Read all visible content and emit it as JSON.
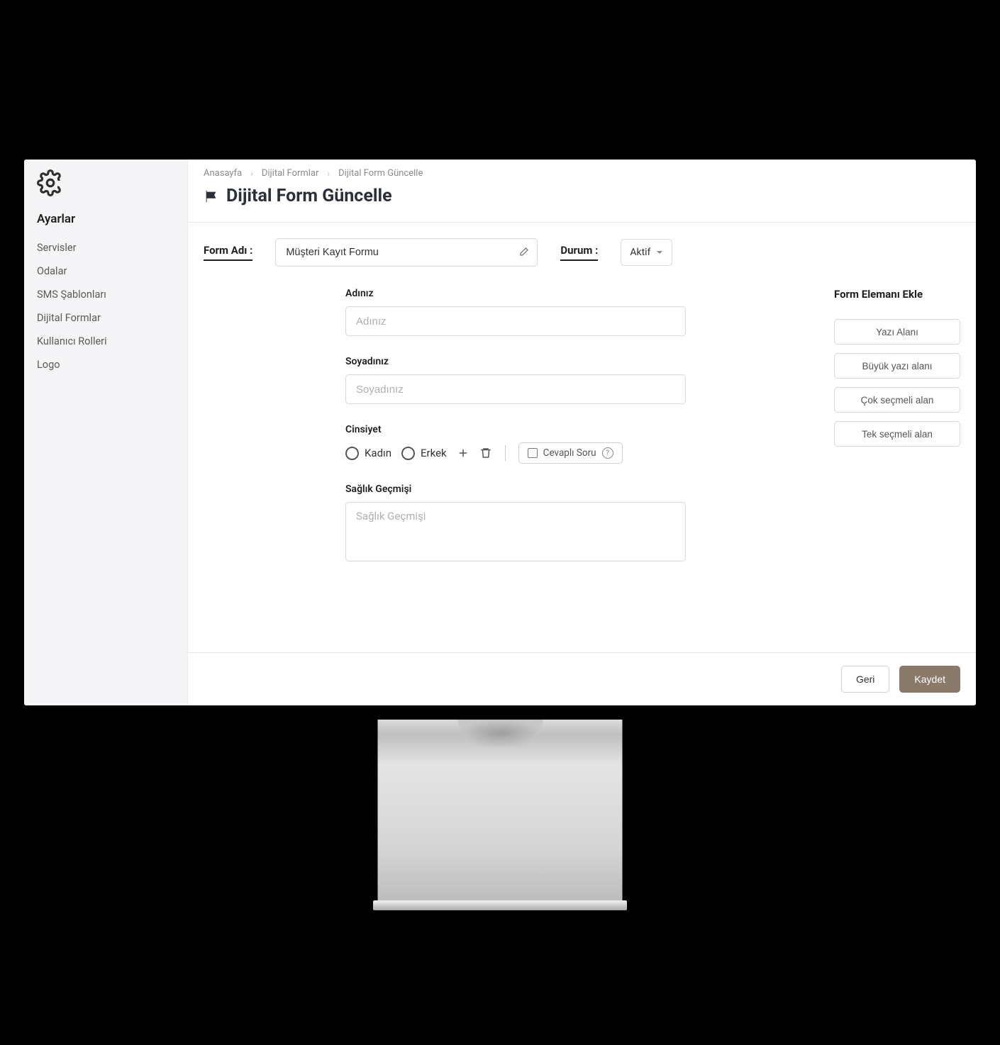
{
  "sidebar": {
    "title": "Ayarlar",
    "items": [
      "Servisler",
      "Odalar",
      "SMS Şablonları",
      "Dijital Formlar",
      "Kullanıcı Rolleri",
      "Logo"
    ]
  },
  "breadcrumbs": [
    "Anasayfa",
    "Dijital Formlar",
    "Dijital Form Güncelle"
  ],
  "page_title": "Dijital Form Güncelle",
  "meta": {
    "form_name_label": "Form Adı :",
    "form_name_value": "Müşteri Kayıt Formu",
    "status_label": "Durum :",
    "status_value": "Aktif"
  },
  "fields": {
    "first_name": {
      "label": "Adınız",
      "placeholder": "Adınız"
    },
    "last_name": {
      "label": "Soyadınız",
      "placeholder": "Soyadınız"
    },
    "gender": {
      "label": "Cinsiyet",
      "options": [
        "Kadın",
        "Erkek"
      ],
      "answered_label": "Cevaplı Soru"
    },
    "health": {
      "label": "Sağlık Geçmişi",
      "placeholder": "Sağlık Geçmişi"
    }
  },
  "element_panel": {
    "title": "Form Elemanı Ekle",
    "buttons": [
      "Yazı Alanı",
      "Büyük yazı alanı",
      "Çok seçmeli alan",
      "Tek seçmeli alan"
    ]
  },
  "footer": {
    "back": "Geri",
    "save": "Kaydet"
  }
}
